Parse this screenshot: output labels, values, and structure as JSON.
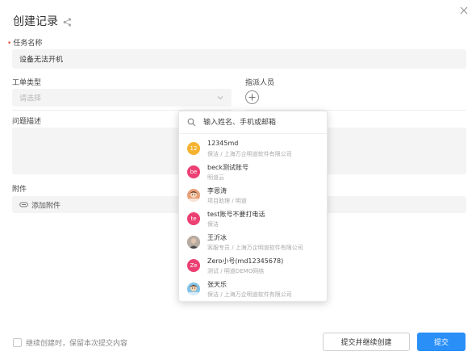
{
  "dialog": {
    "title": "创建记录"
  },
  "task_name": {
    "label": "任务名称",
    "required_mark": "•",
    "value": "设备无法开机"
  },
  "order_type": {
    "label": "工单类型",
    "placeholder": "请选择"
  },
  "assignee": {
    "label": "指派人员"
  },
  "description": {
    "label": "问题描述"
  },
  "attachment": {
    "label": "附件",
    "add_label": "添加附件"
  },
  "footer": {
    "keep_checkbox_label": "继续创建时，保留本次提交内容",
    "submit_continue_label": "提交并继续创建",
    "submit_label": "提交"
  },
  "popover": {
    "search_placeholder": "输入姓名、手机或邮箱",
    "people": [
      {
        "name": "12345md",
        "sub": "保洁 / 上海万企明道软件有限公司",
        "avatar_text": "12",
        "avatar_color": "#f5b32f",
        "avatar_kind": "initials"
      },
      {
        "name": "beck测试账号",
        "sub": "明道云",
        "avatar_text": "be",
        "avatar_color": "#ec3f72",
        "avatar_kind": "initials"
      },
      {
        "name": "李恩涛",
        "sub": "项目助理 / 明道",
        "avatar_text": "",
        "avatar_color": "#e8a07a",
        "avatar_kind": "photo-cartoon"
      },
      {
        "name": "test账号不要打电话",
        "sub": "保洁",
        "avatar_text": "te",
        "avatar_color": "#ec3f72",
        "avatar_kind": "initials"
      },
      {
        "name": "王沂冰",
        "sub": "客服专员 / 上海万企明道软件有限公司",
        "avatar_text": "",
        "avatar_color": "#8d7a6e",
        "avatar_kind": "photo"
      },
      {
        "name": "Zero小号(md12345678)",
        "sub": "测试 / 明道DEMO网络",
        "avatar_text": "Ze",
        "avatar_color": "#ec3f72",
        "avatar_kind": "initials"
      },
      {
        "name": "张天乐",
        "sub": "保洁 / 上海万企明道软件有限公司",
        "avatar_text": "",
        "avatar_color": "#7fc3e6",
        "avatar_kind": "photo-cartoon"
      }
    ]
  },
  "colors": {
    "primary": "#2a8ff7",
    "required": "#f04b3b",
    "field_bg": "#f4f4f4"
  },
  "icons": {
    "share": "share-icon",
    "close": "close-icon",
    "chevron": "chevron-down-icon",
    "add": "plus-icon",
    "paperclip": "paperclip-icon",
    "search": "search-icon"
  }
}
